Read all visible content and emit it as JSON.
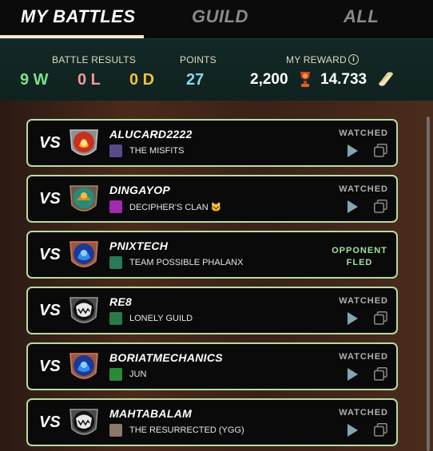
{
  "tabs": [
    {
      "label": "MY BATTLES",
      "active": true
    },
    {
      "label": "GUILD",
      "active": false
    },
    {
      "label": "ALL",
      "active": false
    }
  ],
  "summary": {
    "battle_results_label": "BATTLE RESULTS",
    "wins": "9 W",
    "losses": "0 L",
    "draws": "0 D",
    "points_label": "POINTS",
    "points": "27",
    "reward_label": "MY REWARD",
    "info_icon": "i",
    "reward_amount": "2,200",
    "reward_icon": "trophy-icon",
    "reward_secondary": "14.733",
    "reward_secondary_icon": "scroll-icon"
  },
  "colors": {
    "win": "#7ee08a",
    "loss": "#f09a9a",
    "draw": "#f0c23c",
    "points": "#8ad8ee",
    "card_border": "#b8dca2",
    "opponent_fled": "#9fe0a0"
  },
  "battles": [
    {
      "vs": "VS",
      "opponent": "ALUCARD2222",
      "guild": "THE MISFITS",
      "status": "WATCHED",
      "avatar": "fire-avatar",
      "guild_color": "#5a4a8a"
    },
    {
      "vs": "VS",
      "opponent": "DINGAYOP",
      "guild": "DECIPHER'S CLAN 🐱",
      "status": "WATCHED",
      "avatar": "earth-avatar",
      "guild_color": "#a02ab0"
    },
    {
      "vs": "VS",
      "opponent": "PNIXTECH",
      "guild": "TEAM POSSIBLE PHALANX",
      "status": "OPPONENT FLED",
      "avatar": "water-avatar",
      "guild_color": "#2a7a5a"
    },
    {
      "vs": "VS",
      "opponent": "RE8",
      "guild": "LONELY GUILD",
      "status": "WATCHED",
      "avatar": "monster-avatar",
      "guild_color": "#2a7a4a"
    },
    {
      "vs": "VS",
      "opponent": "BORIATMECHANICS",
      "guild": "JUN",
      "status": "WATCHED",
      "avatar": "water-avatar",
      "guild_color": "#2a8a3a"
    },
    {
      "vs": "VS",
      "opponent": "MAHTABALAM",
      "guild": "THE RESURRECTED (YGG)",
      "status": "WATCHED",
      "avatar": "monster-avatar",
      "guild_color": "#8a7a6a"
    }
  ]
}
